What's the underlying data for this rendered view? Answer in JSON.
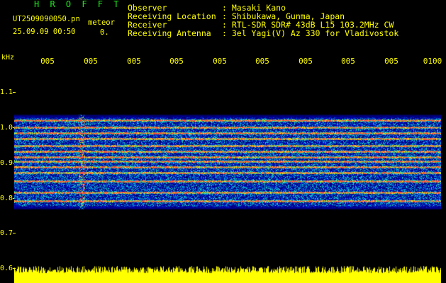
{
  "header": {
    "brand": "H R O F F T",
    "filename": "UT2509090050.pn",
    "mode": "meteor",
    "timestamp": "25.09.09 00:50",
    "count": "0."
  },
  "metadata": [
    {
      "label": "Observer",
      "value": ": Masaki Kano"
    },
    {
      "label": "Receiving Location",
      "value": ": Shibukawa, Gunma, Japan"
    },
    {
      "label": "Receiver",
      "value": ": RTL-SDR SDR# 43dB L15 103.2MHz CW"
    },
    {
      "label": "Receiving Antenna",
      "value": ": 3el Yagi(V) Az 330 for Vladivostok"
    }
  ],
  "axis": {
    "unit": "kHz",
    "time_ticks": [
      "005",
      "005",
      "005",
      "005",
      "005",
      "005",
      "005",
      "005",
      "005",
      "0100"
    ],
    "freq_ticks": [
      "1.1",
      "1.0",
      "0.9",
      "0.8",
      "0.7",
      "0.6"
    ]
  },
  "colors": {
    "text": "#ffff00",
    "brand": "#1fe81f",
    "background": "#000000",
    "noise_floor": "#ffff00"
  }
}
